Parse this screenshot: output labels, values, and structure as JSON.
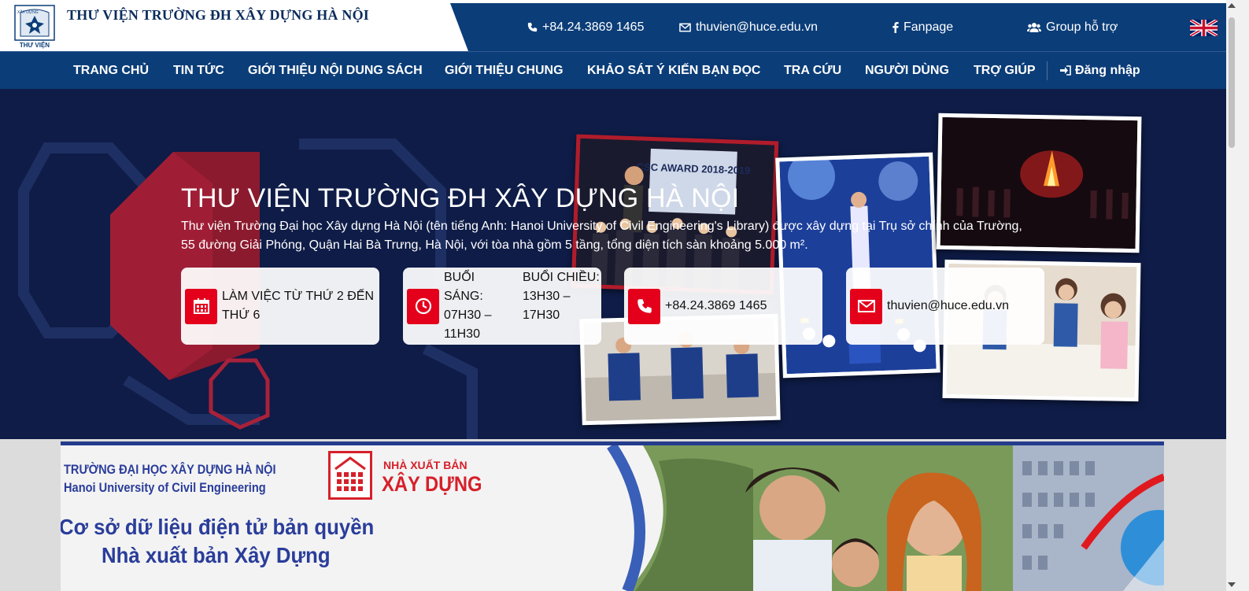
{
  "header": {
    "logo_text": "THƯ VIỆN",
    "logo_arc_text": "XÂY DỰNG",
    "site_title": "THƯ VIỆN TRƯỜNG ĐH XÂY DỰNG HÀ NỘI",
    "phone": "+84.24.3869 1465",
    "email": "thuvien@huce.edu.vn",
    "fanpage": "Fanpage",
    "support_group": "Group hỗ trợ",
    "language_flag": "uk-flag-icon"
  },
  "nav": {
    "items": [
      {
        "label": "TRANG CHỦ"
      },
      {
        "label": "TIN TỨC"
      },
      {
        "label": "GIỚI THIỆU NỘI DUNG SÁCH"
      },
      {
        "label": "GIỚI THIỆU CHUNG"
      },
      {
        "label": "KHẢO SÁT Ý KIẾN BẠN ĐỌC"
      },
      {
        "label": "TRA CỨU"
      },
      {
        "label": "NGƯỜI DÙNG"
      },
      {
        "label": "TRỢ GIÚP"
      }
    ],
    "login": "Đăng nhập"
  },
  "hero": {
    "title": "THƯ VIỆN TRƯỜNG ĐH XÂY DỰNG HÀ NỘI",
    "description": "Thư viện Trường Đại học Xây dựng Hà Nội (tên tiếng Anh: Hanoi University of Civil Engineering's Library) được xây dựng tại Trụ sở chính của Trường, 55 đường Giải Phóng, Quận Hai Bà Trưng, Hà Nội, với tòa nhà gồm 5 tầng, tổng diện tích sàn khoảng 5.000 m².",
    "photo_caption": "CSC AWARD 2018-2019",
    "cards": {
      "working_days": "LÀM VIỆC TỪ THỨ 2 ĐẾN THỨ 6",
      "morning_label": "BUỔI SÁNG:",
      "morning_hours": "07H30 – 11H30",
      "afternoon_label": "BUỔI CHIỀU:",
      "afternoon_hours": "13H30 – 17H30",
      "phone": "+84.24.3869 1465",
      "email": "thuvien@huce.edu.vn"
    }
  },
  "banner": {
    "university_vn": "TRƯỜNG ĐẠI HỌC XÂY DỰNG HÀ NỘI",
    "university_en": "Hanoi University of Civil Engineering",
    "publisher_small": "NHÀ XUẤT BẢN",
    "publisher_big": "XÂY DỰNG",
    "db_line1": "Cơ sở dữ liệu điện tử bản quyền",
    "db_line2": "Nhà xuất bản Xây Dựng"
  },
  "colors": {
    "navy": "#0b3d78",
    "hero_bg": "#0e1c47",
    "accent_red": "#e4001b",
    "banner_blue": "#2a3d9a"
  }
}
